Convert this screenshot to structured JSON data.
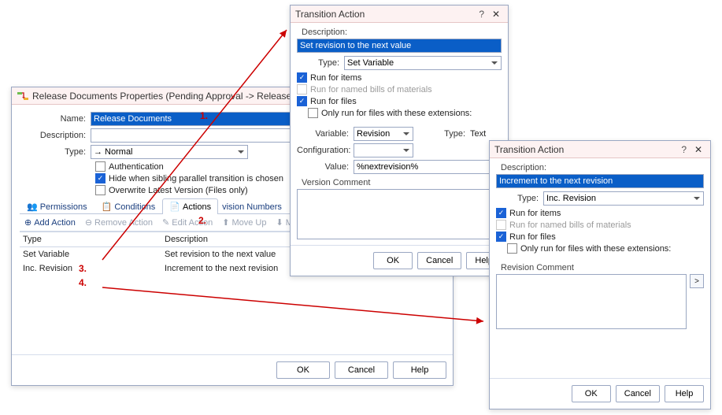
{
  "main": {
    "title": "Release Documents Properties (Pending Approval -> Released for Produ",
    "name_label": "Name:",
    "name_value": "Release Documents",
    "desc_label": "Description:",
    "desc_value": "",
    "type_label": "Type:",
    "type_value": "→ Normal",
    "chk_auth": "Authentication",
    "chk_hide": "Hide when sibling parallel transition is chosen",
    "chk_overwrite": "Overwrite Latest Version (Files only)",
    "tabs": {
      "permissions": "Permissions",
      "conditions": "Conditions",
      "actions": "Actions",
      "revision_numbers": "vision Numbers",
      "notifications": "Nc"
    },
    "toolbar": {
      "add": "Add Action",
      "remove": "Remove Action",
      "edit": "Edit Action",
      "moveup": "Move Up",
      "movedown": "Mc"
    },
    "grid": {
      "col_type": "Type",
      "col_desc": "Description",
      "rows": [
        {
          "type": "Set Variable",
          "desc": "Set revision to the next value"
        },
        {
          "type": "Inc. Revision",
          "desc": "Increment to the next revision"
        }
      ]
    },
    "buttons": {
      "ok": "OK",
      "cancel": "Cancel",
      "help": "Help"
    }
  },
  "dlg_top": {
    "title": "Transition Action",
    "desc_label": "Description:",
    "desc_value": "Set revision to the next value",
    "type_label": "Type:",
    "type_value": "Set Variable",
    "chk_items": "Run for items",
    "chk_boms": "Run for named bills of materials",
    "chk_files": "Run for files",
    "chk_ext": "Only run for files with these extensions:",
    "var_label": "Variable:",
    "var_value": "Revision",
    "vtype_label": "Type:",
    "vtype_value": "Text",
    "config_label": "Configuration:",
    "config_value": "",
    "value_label": "Value:",
    "value_value": "%nextrevision%",
    "vcomment_label": "Version Comment",
    "buttons": {
      "ok": "OK",
      "cancel": "Cancel",
      "help": "Help"
    }
  },
  "dlg_right": {
    "title": "Transition Action",
    "desc_label": "Description:",
    "desc_value": "Increment to the next revision",
    "type_label": "Type:",
    "type_value": "Inc. Revision",
    "chk_items": "Run for items",
    "chk_boms": "Run for named bills of materials",
    "chk_files": "Run for files",
    "chk_ext": "Only run for files with these extensions:",
    "rcomment_label": "Revision Comment",
    "buttons": {
      "ok": "OK",
      "cancel": "Cancel",
      "help": "Help"
    }
  },
  "annotations": {
    "a1": "1.",
    "a2": "2.",
    "a3": "3.",
    "a4": "4."
  }
}
